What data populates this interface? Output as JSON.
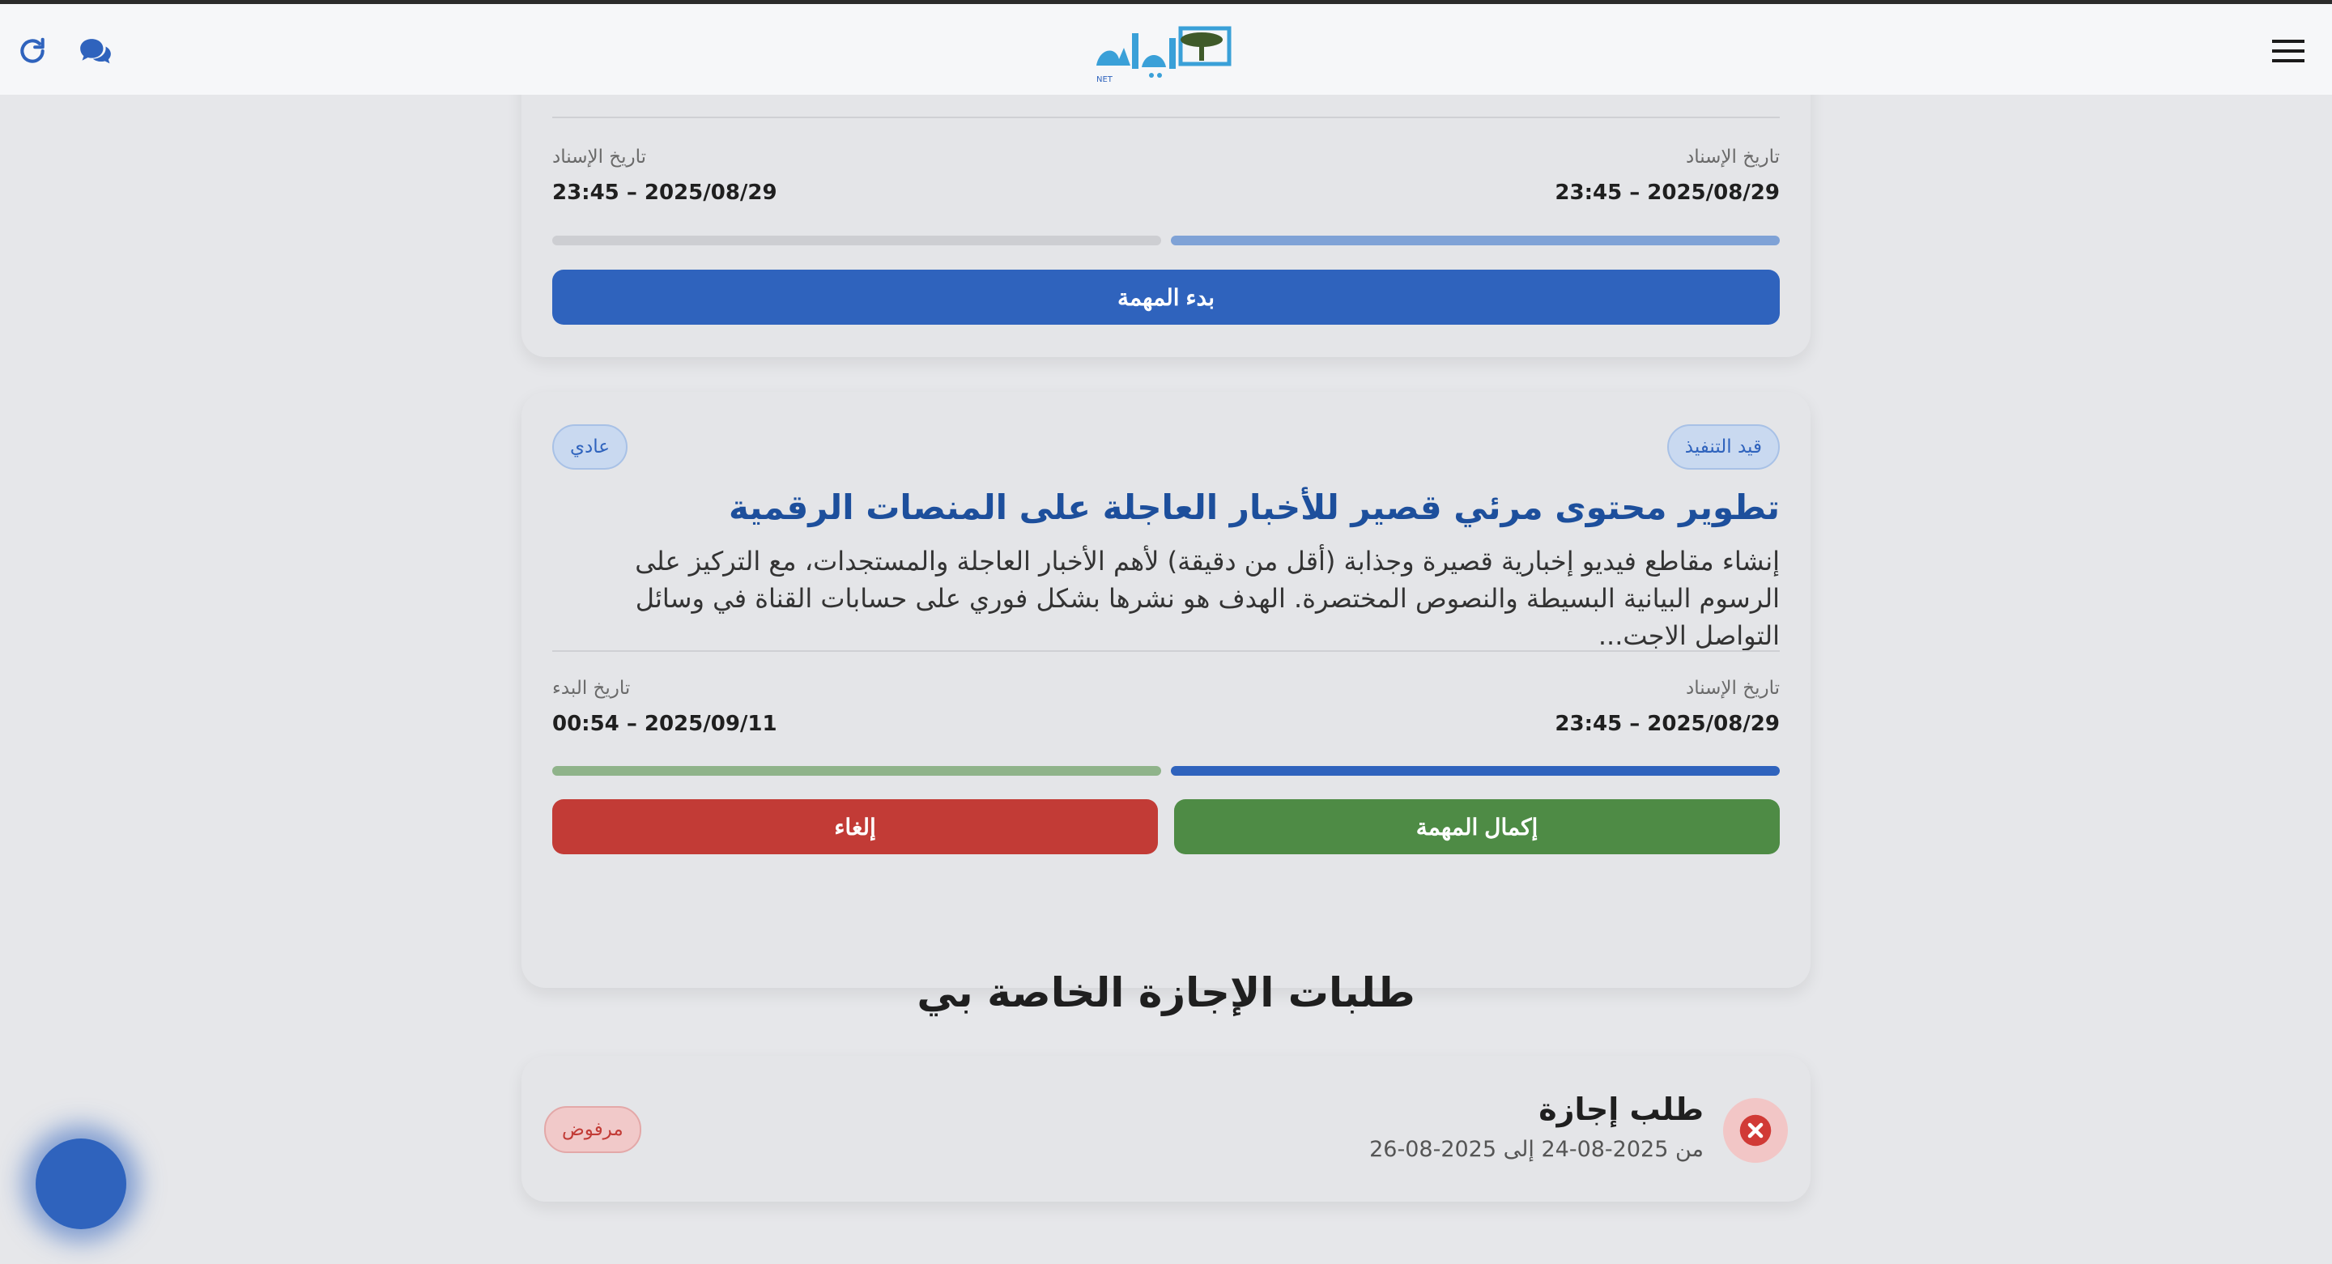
{
  "header": {
    "logo_alt": "المهرية NET",
    "refresh_icon": "refresh-icon",
    "chat_icon": "chat-icon",
    "menu_icon": "menu-icon"
  },
  "tasks": [
    {
      "assigned_label": "تاريخ الإسناد",
      "assigned_value": "23:45 – 2025/08/29",
      "second_label": "تاريخ الإسناد",
      "second_value": "23:45 – 2025/08/29",
      "action_label": "بدء المهمة"
    },
    {
      "status": "قيد التنفيذ",
      "priority": "عادي",
      "title": "تطوير محتوى مرئي قصير للأخبار العاجلة على المنصات الرقمية",
      "description": "إنشاء مقاطع فيديو إخبارية قصيرة وجذابة (أقل من دقيقة) لأهم الأخبار العاجلة والمستجدات، مع التركيز على الرسوم البيانية البسيطة والنصوص المختصرة. الهدف هو نشرها بشكل فوري على حسابات القناة في وسائل التواصل الاجت...",
      "assigned_label": "تاريخ الإسناد",
      "assigned_value": "23:45 – 2025/08/29",
      "start_label": "تاريخ البدء",
      "start_value": "00:54 – 2025/09/11",
      "complete_label": "إكمال المهمة",
      "cancel_label": "إلغاء"
    }
  ],
  "leave": {
    "section_title": "طلبات الإجازة الخاصة بي",
    "item_title": "طلب إجازة",
    "item_dates": "من 2025-08-24 إلى 2025-08-26",
    "status": "مرفوض"
  },
  "colors": {
    "primary": "#2f63bd",
    "success": "#4e8b45",
    "danger": "#c23b36",
    "title": "#1d4f9c"
  }
}
